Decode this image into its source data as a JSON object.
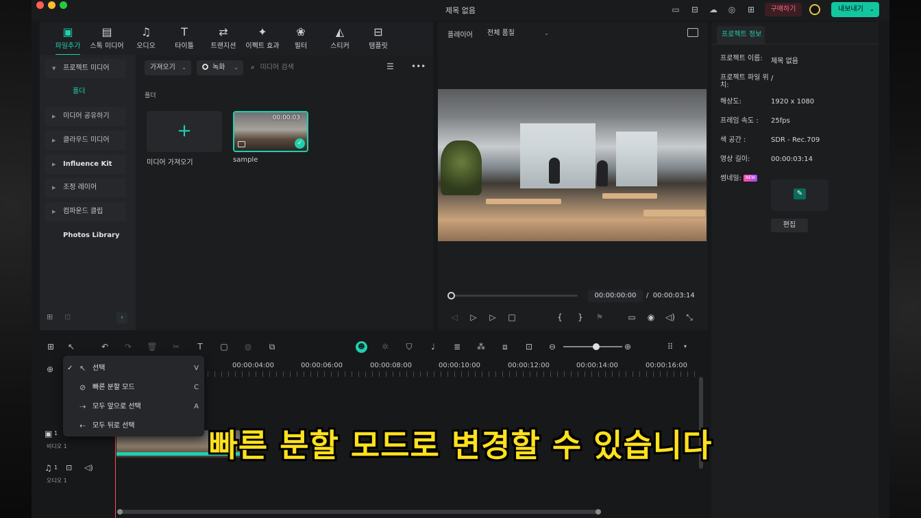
{
  "window": {
    "title": "제목 없음"
  },
  "titlebar": {
    "buy_label": "구매하기",
    "export_label": "내보내기"
  },
  "tool_tabs": [
    {
      "label": "파일추가",
      "icon": "media-icon"
    },
    {
      "label": "스톡 미디어",
      "icon": "stock-media-icon"
    },
    {
      "label": "오디오",
      "icon": "music-note-icon"
    },
    {
      "label": "타이틀",
      "icon": "title-t-icon"
    },
    {
      "label": "트랜지션",
      "icon": "transition-icon"
    },
    {
      "label": "이펙트 효과",
      "icon": "effects-icon"
    },
    {
      "label": "필터",
      "icon": "filter-icon"
    },
    {
      "label": "스티커",
      "icon": "sticker-icon"
    },
    {
      "label": "템플릿",
      "icon": "template-icon"
    }
  ],
  "sidebar": {
    "items": [
      {
        "label": "프로젝트 미디어"
      },
      {
        "label": "폴더"
      },
      {
        "label": "미디어 공유하기"
      },
      {
        "label": "클라우드 미디어"
      },
      {
        "label": "Influence Kit"
      },
      {
        "label": "조정 레이어"
      },
      {
        "label": "컴파운드 클립"
      },
      {
        "label": "Photos Library"
      }
    ]
  },
  "media": {
    "import_dropdown": "가져오기",
    "record_dropdown": "녹화",
    "search_placeholder": "미디어 검색",
    "folder_label": "폴더",
    "import_tile_label": "미디어 가져오기",
    "clip": {
      "name": "sample",
      "duration": "00:00:03"
    }
  },
  "player": {
    "label": "플레이어",
    "quality": "전체 품질",
    "current_time": "00:00:00:00",
    "total_time": "00:00:03:14",
    "time_separator": "/"
  },
  "project_info": {
    "tab": "프로젝트 정보",
    "rows": [
      {
        "key": "프로젝트 이름:",
        "value": "제목 없음"
      },
      {
        "key": "프로젝트 파일 위치:",
        "value": "/"
      },
      {
        "key": "해상도:",
        "value": "1920 x 1080"
      },
      {
        "key": "프레임 속도 :",
        "value": "25fps"
      },
      {
        "key": "색 공간 :",
        "value": "SDR - Rec.709"
      },
      {
        "key": "영상 길이:",
        "value": "00:00:03:14"
      }
    ],
    "thumbnail_label": "썸네일:",
    "new_badge": "NEW",
    "edit_button": "편집"
  },
  "timeline": {
    "ruler": [
      "00:00:04:00",
      "00:00:06:00",
      "00:00:08:00",
      "00:00:10:00",
      "00:00:12:00",
      "00:00:14:00",
      "00:00:16:00"
    ],
    "video_track_label": "비디오 1",
    "audio_track_label": "오디오 1",
    "video_track_num": "1",
    "audio_track_num": "1"
  },
  "select_menu": {
    "items": [
      {
        "label": "선택",
        "key": "V",
        "checked": true,
        "icon": "pointer-icon"
      },
      {
        "label": "빠른 분할 모드",
        "key": "C",
        "checked": false,
        "icon": "blade-icon"
      },
      {
        "label": "모두 앞으로 선택",
        "key": "A",
        "checked": false,
        "icon": "select-forward-icon"
      },
      {
        "label": "모두 뒤로 선택",
        "key": "",
        "checked": false,
        "icon": "select-backward-icon"
      }
    ]
  },
  "subtitle": "빠른 분할 모드로 변경할 수 있습니다",
  "colors": {
    "accent": "#1fd0ae",
    "buy": "#ff6a7a",
    "playhead": "#ff4d5d",
    "subtitle": "#ffe11c"
  }
}
